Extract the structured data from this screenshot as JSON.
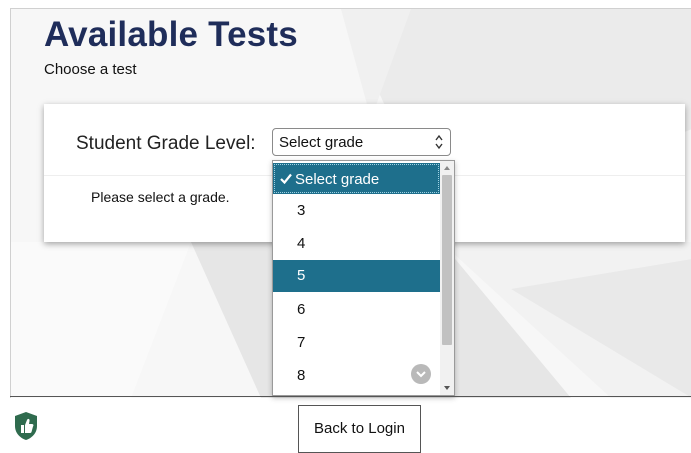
{
  "header": {
    "title": "Available Tests",
    "subtitle": "Choose a test"
  },
  "grade_form": {
    "label": "Student Grade Level:",
    "selected": "Select grade",
    "message": "Please select a grade.",
    "options": [
      {
        "label": "Select grade",
        "checked": true
      },
      {
        "label": "3"
      },
      {
        "label": "4"
      },
      {
        "label": "5",
        "highlighted": true
      },
      {
        "label": "6"
      },
      {
        "label": "7"
      },
      {
        "label": "8"
      }
    ]
  },
  "footer": {
    "back_label": "Back to Login",
    "logo_icon": "shield-thumb-icon"
  },
  "colors": {
    "title": "#1f2d5a",
    "highlight": "#1e6f8c",
    "logo": "#2f6b4e"
  }
}
